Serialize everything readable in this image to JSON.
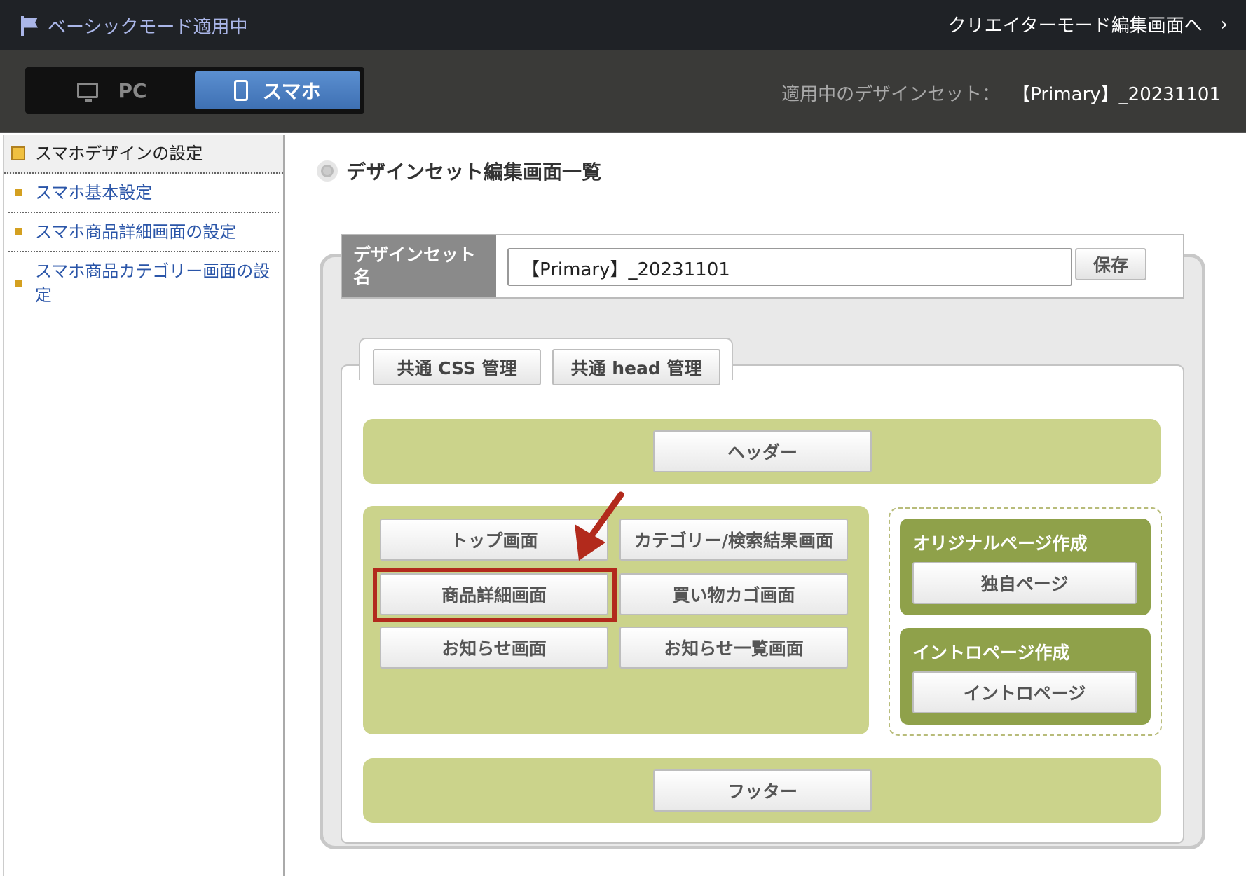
{
  "topbar": {
    "mode_label": "ベーシックモード適用中",
    "creator_link": "クリエイターモード編集画面へ",
    "chevron": "›"
  },
  "device_switch": {
    "pc_label": "PC",
    "sp_label": "スマホ",
    "active": "スマホ"
  },
  "design_set": {
    "label": "適用中のデザインセット：",
    "value": "【Primary】_20231101"
  },
  "sidebar": {
    "items": [
      {
        "label": "スマホデザインの設定",
        "type": "header"
      },
      {
        "label": "スマホ基本設定"
      },
      {
        "label": "スマホ商品詳細画面の設定"
      },
      {
        "label": "スマホ商品カテゴリー画面の設定"
      }
    ]
  },
  "main": {
    "title": "デザインセット編集画面一覧",
    "name_label": "デザインセット名",
    "name_value": "【Primary】_20231101",
    "save_label": "保存",
    "tabs": {
      "css": "共通 CSS 管理",
      "head": "共通 head 管理"
    },
    "header_btn": "ヘッダー",
    "pages": {
      "top": "トップ画面",
      "category": "カテゴリー/検索結果画面",
      "product": "商品詳細画面",
      "cart": "買い物カゴ画面",
      "news": "お知らせ画面",
      "news_list": "お知らせ一覧画面"
    },
    "original": {
      "title": "オリジナルページ作成",
      "button": "独自ページ"
    },
    "intro": {
      "title": "イントロページ作成",
      "button": "イントロページ"
    },
    "footer_btn": "フッター"
  },
  "colors": {
    "green_area": "#cbd38b",
    "olive_area": "#8fa14a",
    "highlight": "#b22a1c",
    "active_tab": "#4a7fc1"
  }
}
